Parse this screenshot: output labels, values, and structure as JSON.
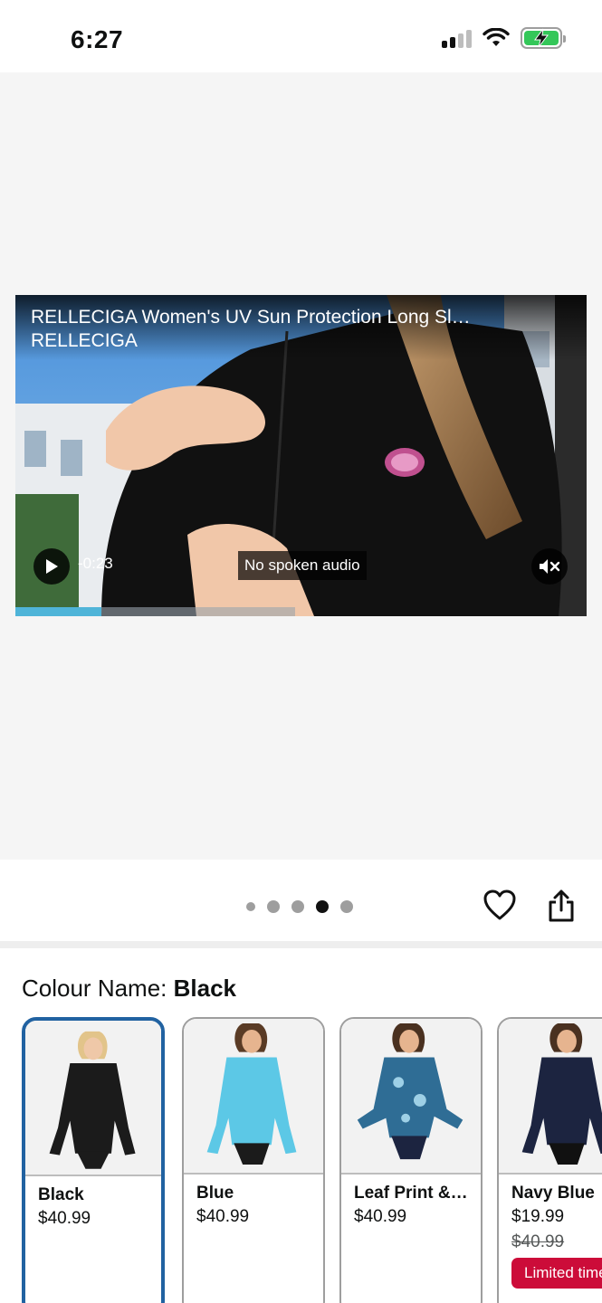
{
  "status_bar": {
    "time": "6:27"
  },
  "video": {
    "title": "RELLECIGA Women's UV Sun Protection Long Sl…",
    "brand": "RELLECIGA",
    "time_remaining": "-0:23",
    "caption": "No spoken audio",
    "progress": 0.15,
    "buffered": 0.49
  },
  "carousel": {
    "dot_count": 5,
    "active_index": 3
  },
  "colour": {
    "label": "Colour Name:",
    "selected": "Black"
  },
  "swatches": [
    {
      "name": "Black",
      "price": "$40.99",
      "shirt_color": "#1b1b1b",
      "selected": true
    },
    {
      "name": "Blue",
      "price": "$40.99",
      "shirt_color": "#5cc8e6",
      "selected": false
    },
    {
      "name": "Leaf Print &…",
      "price": "$40.99",
      "shirt_color": "#2f6d95",
      "selected": false
    },
    {
      "name": "Navy Blue",
      "price": "$19.99",
      "old_price": "$40.99",
      "deal": "Limited time deal",
      "shirt_color": "#1c2440",
      "selected": false
    }
  ],
  "colors": {
    "accent": "#2162a1",
    "deal": "#cc0c39",
    "progress": "#4fb4d8"
  }
}
